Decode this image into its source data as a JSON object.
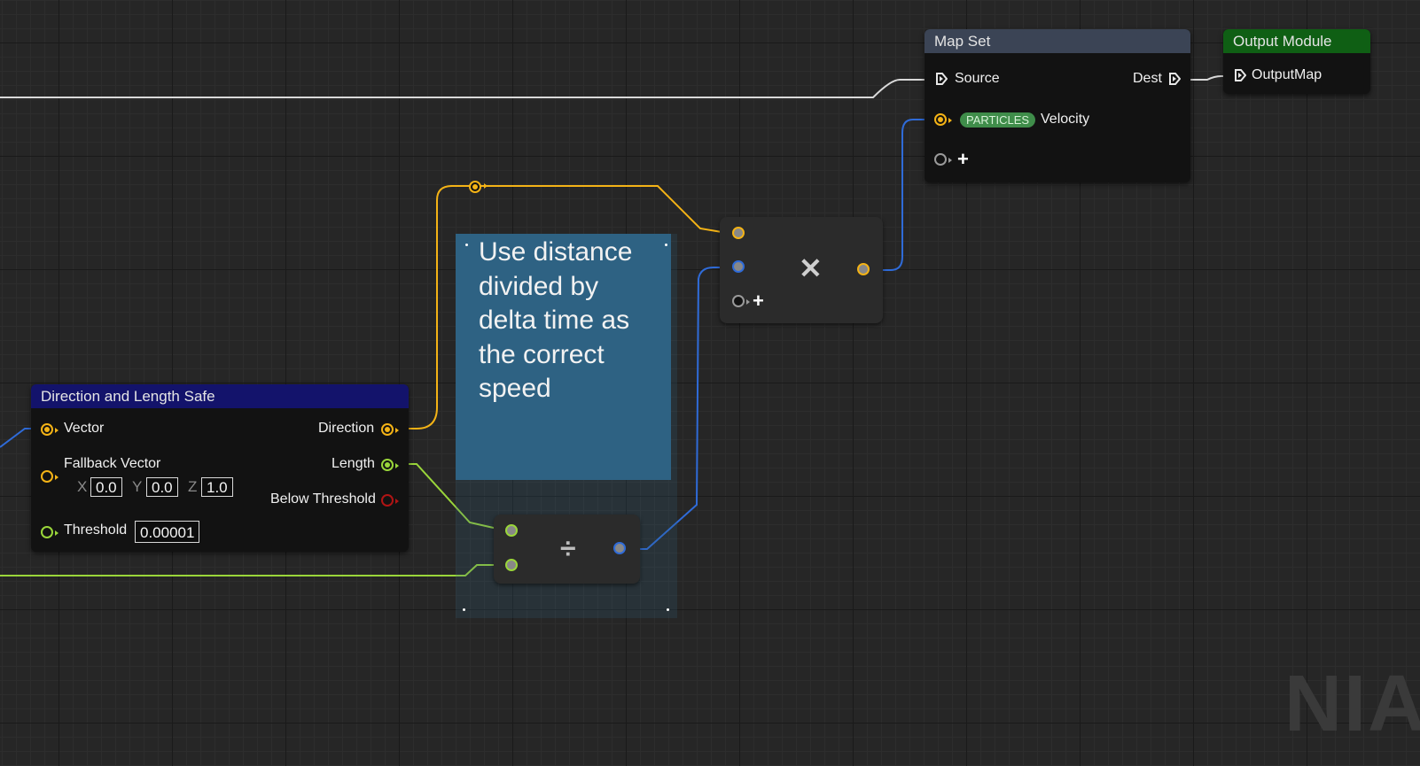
{
  "colors": {
    "float": "#f4b316",
    "scalar": "#9ad63a",
    "bool": "#b01414",
    "position": "#2f6bd8",
    "exec": "#d9d9d9",
    "map_set_header": "#3b4455",
    "output_module_header": "#0f5f14",
    "direction_length_header": "#13136b",
    "comment_bg": "#2e6283"
  },
  "map_set": {
    "title": "Map Set",
    "source_label": "Source",
    "dest_label": "Dest",
    "particles_badge": "PARTICLES",
    "velocity_label": "Velocity",
    "add_icon": "plus-icon"
  },
  "output_module": {
    "title": "Output Module",
    "output_map_label": "OutputMap"
  },
  "direction_length": {
    "title": "Direction and Length Safe",
    "vector_label": "Vector",
    "direction_label": "Direction",
    "fallback_label": "Fallback Vector",
    "length_label": "Length",
    "below_threshold_label": "Below Threshold",
    "threshold_label": "Threshold",
    "axis_x": "X",
    "x_value": "0.0",
    "axis_y": "Y",
    "y_value": "0.0",
    "axis_z": "Z",
    "z_value": "1.0",
    "threshold_value": "0.00001"
  },
  "multiply_node": {
    "symbol": "✕",
    "icon": "multiply-icon"
  },
  "divide_node": {
    "symbol": "÷",
    "icon": "divide-icon"
  },
  "comment": {
    "text": "Use distance divided by delta time as the correct speed"
  },
  "watermark": "NIA"
}
